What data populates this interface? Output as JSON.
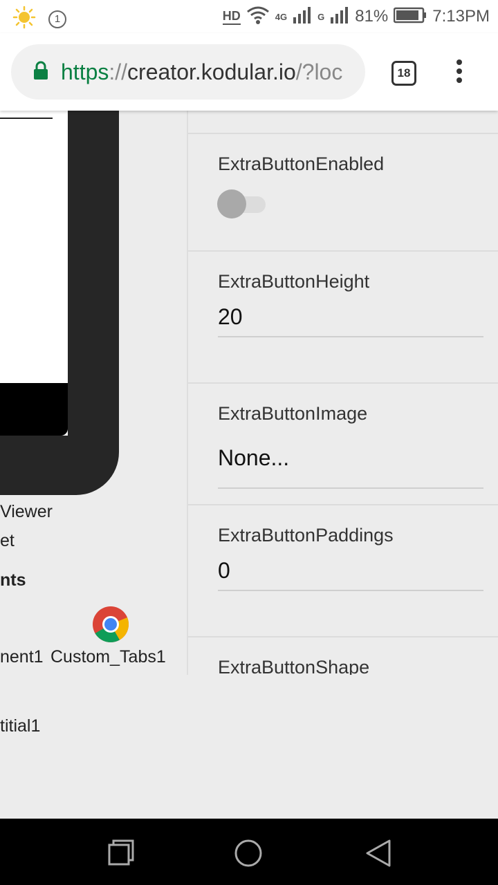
{
  "status_bar": {
    "hd_label": "HD",
    "network_4g": "4G",
    "network_g": "G",
    "battery_percent": "81%",
    "time": "7:13PM",
    "notification_count": "1"
  },
  "browser": {
    "url_scheme": "https",
    "url_sep": "://",
    "url_host": "creator.kodular.io",
    "url_rest": "/?loc",
    "tab_count": "18"
  },
  "left_panel": {
    "viewer_label": "Viewer",
    "et_label": "et",
    "components_heading": "nts",
    "component_a": "nent1",
    "component_b": "Custom_Tabs1",
    "component_c": "titial1"
  },
  "properties": [
    {
      "label": "ExtraButtonEnabled",
      "type": "switch",
      "on": false
    },
    {
      "label": "ExtraButtonHeight",
      "value": "20"
    },
    {
      "label": "ExtraButtonImage",
      "value": "None..."
    },
    {
      "label": "ExtraButtonPaddings",
      "value": "0"
    },
    {
      "label": "ExtraButtonShape"
    }
  ],
  "colors": {
    "secure_green": "#0b8043",
    "page_bg": "#ececec",
    "switch_thumb_off": "#a9a9a9"
  },
  "icons": {
    "status_left": [
      "sun-icon",
      "notification-count-icon"
    ],
    "status_right": [
      "wifi-icon",
      "signal-icon",
      "battery-icon"
    ],
    "browser": [
      "lock-icon",
      "tab-switcher-icon",
      "menu-icon"
    ],
    "component": "chrome-icon",
    "nav": [
      "recents-icon",
      "home-icon",
      "back-icon"
    ]
  }
}
